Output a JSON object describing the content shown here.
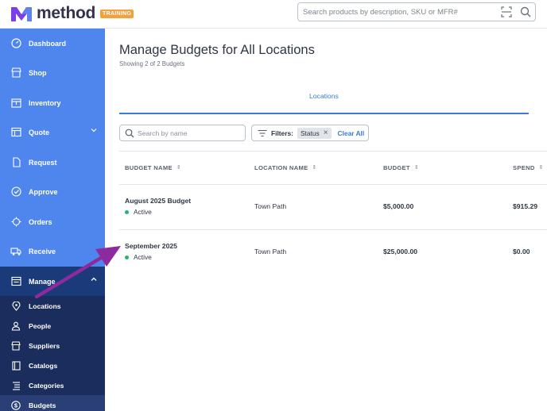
{
  "app": {
    "name": "method",
    "badge": "TRAINING",
    "brand_colors": {
      "logo_purple": "#7b3fe4",
      "logo_blue": "#5a8dee",
      "badge": "#f4a03c"
    }
  },
  "search": {
    "placeholder": "Search products by description, SKU or MFR#",
    "value": ""
  },
  "sidebar": {
    "color": "#4f86ee",
    "items": [
      {
        "label": "Dashboard",
        "icon": "dashboard-icon"
      },
      {
        "label": "Shop",
        "icon": "shop-icon"
      },
      {
        "label": "Inventory",
        "icon": "inventory-icon"
      },
      {
        "label": "Quote",
        "icon": "quote-icon"
      },
      {
        "label": "Request",
        "icon": "document-icon"
      },
      {
        "label": "Approve",
        "icon": "check-circle-icon"
      },
      {
        "label": "Orders",
        "icon": "orders-icon"
      },
      {
        "label": "Receive",
        "icon": "truck-icon"
      },
      {
        "label": "Manage",
        "icon": "manage-icon"
      }
    ],
    "manage_sub": [
      {
        "label": "Locations",
        "icon": "map-pin-icon"
      },
      {
        "label": "People",
        "icon": "people-icon"
      },
      {
        "label": "Suppliers",
        "icon": "suppliers-icon"
      },
      {
        "label": "Catalogs",
        "icon": "book-icon"
      },
      {
        "label": "Categories",
        "icon": "categories-icon"
      },
      {
        "label": "Budgets",
        "icon": "dollar-icon"
      }
    ]
  },
  "main": {
    "title": "Manage Budgets for All Locations",
    "subtitle": "Showing 2 of 2 Budgets",
    "tab": "Locations",
    "name_search": {
      "placeholder": "Search by name",
      "value": ""
    },
    "filters": {
      "label": "Filters:",
      "chip": "Status",
      "clear": "Clear All"
    },
    "table": {
      "columns": [
        "BUDGET NAME",
        "LOCATION NAME",
        "BUDGET",
        "SPEND"
      ],
      "rows": [
        {
          "name": "August 2025 Budget",
          "status": "Active",
          "location": "Town Path",
          "budget": "$5,000.00",
          "spend": "$915.29"
        },
        {
          "name": "September 2025",
          "status": "Active",
          "location": "Town Path",
          "budget": "$25,000.00",
          "spend": "$0.00"
        }
      ]
    }
  }
}
